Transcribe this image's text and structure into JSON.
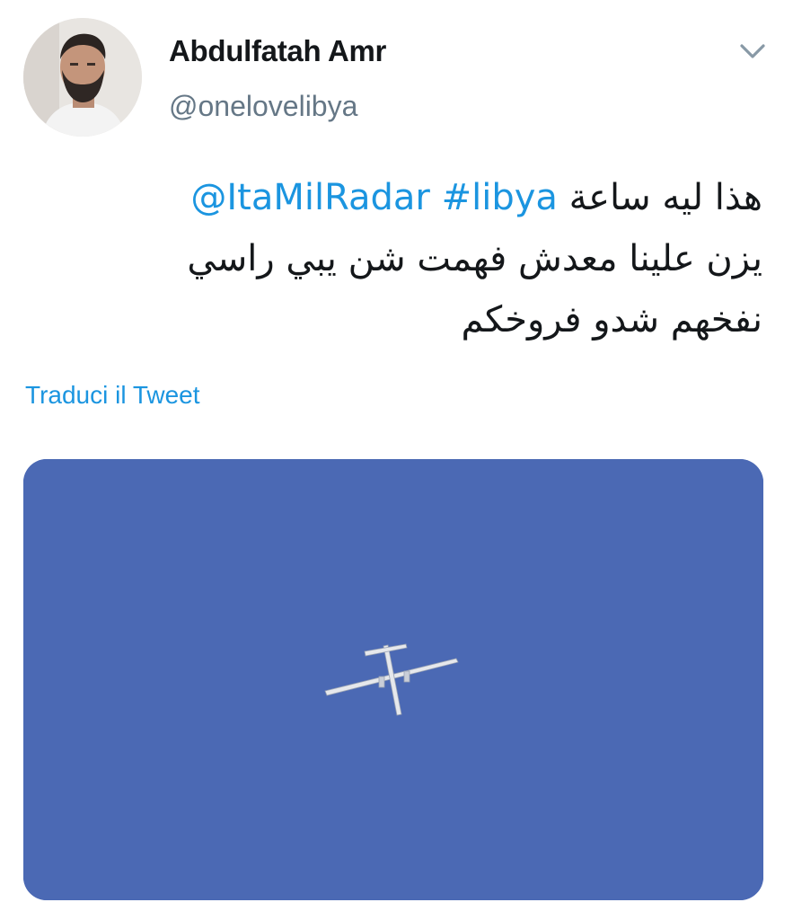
{
  "author": {
    "display_name": "Abdulfatah Amr",
    "handle": "@onelovelibya",
    "avatar_icon": "user-avatar"
  },
  "menu_icon": "chevron-down-icon",
  "tweet": {
    "mention": "@ItaMilRadar",
    "hashtag": "#libya",
    "line1_text": "هذا ليه ساعة",
    "line2_text": "يزن علينا معدش فهمت شن يبي راسي",
    "line3_text": "نفخهم شدو فروخكم"
  },
  "translate_label": "Traduci il Tweet",
  "media": {
    "icon": "aircraft-in-sky-photo",
    "sky_color": "#4a68b3"
  },
  "colors": {
    "link": "#1b95e0",
    "text": "#14171a",
    "secondary": "#657786"
  }
}
